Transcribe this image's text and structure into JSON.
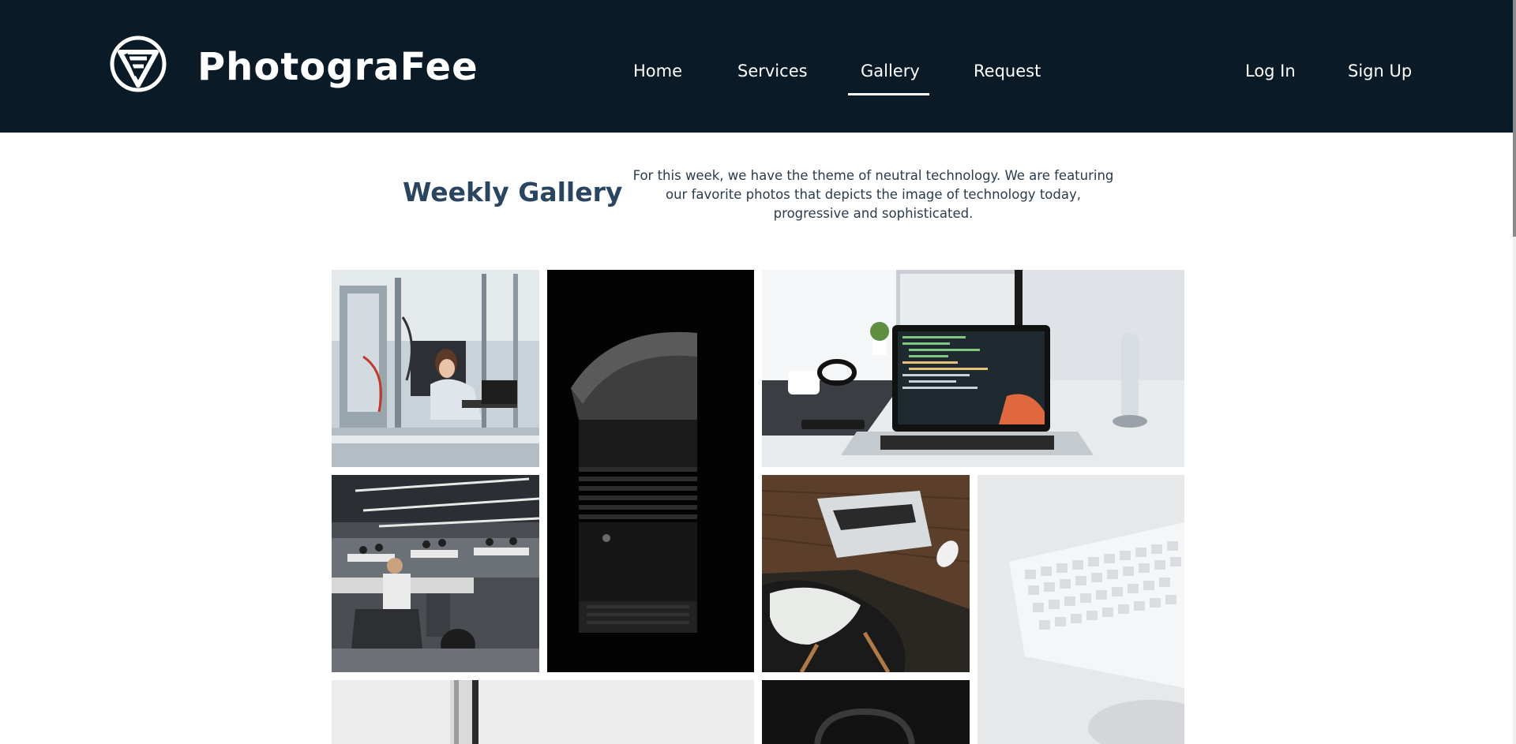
{
  "header": {
    "brand": "PhotograFee",
    "logo_icon": "photografee-logo-icon",
    "nav": [
      {
        "label": "Home",
        "active": false
      },
      {
        "label": "Services",
        "active": false
      },
      {
        "label": "Gallery",
        "active": true
      },
      {
        "label": "Request",
        "active": false
      }
    ],
    "auth": {
      "login": "Log In",
      "signup": "Sign Up"
    },
    "background_color": "#0b1a27",
    "text_color": "#ffffff"
  },
  "intro": {
    "title": "Weekly Gallery",
    "description": "For this week, we have the theme of neutral technology. We are featuring our favorite photos that depicts the image of technology today, progressive and sophisticated.",
    "title_color": "#2a4560"
  },
  "gallery": {
    "photos": [
      {
        "subject": "woman-working-laptop-in-lab-photo"
      },
      {
        "subject": "camera-lens-dark-photo"
      },
      {
        "subject": "laptop-code-on-desk-photo"
      },
      {
        "subject": "open-office-workers-photo"
      },
      {
        "subject": "laptop-on-wooden-desk-with-chair-photo"
      },
      {
        "subject": "white-keyboard-closeup-photo"
      },
      {
        "subject": "white-wall-window-photo"
      },
      {
        "subject": "dark-headphones-photo"
      }
    ]
  }
}
